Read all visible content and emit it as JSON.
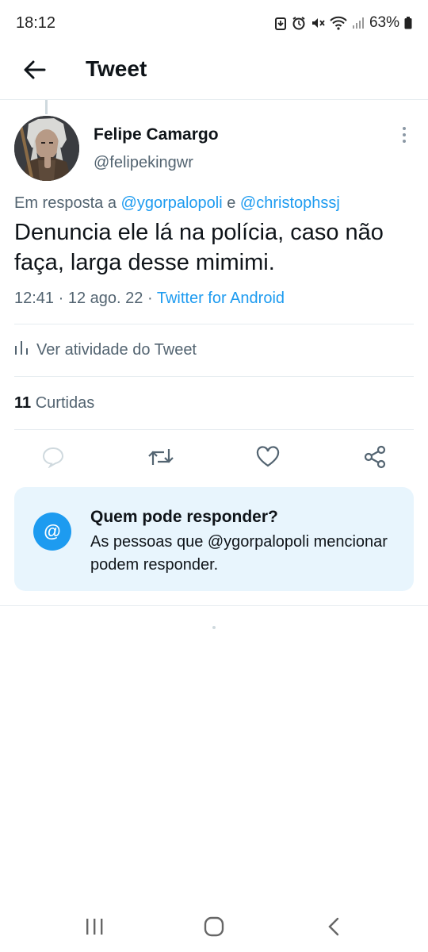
{
  "status_bar": {
    "time": "18:12",
    "battery": "63%",
    "icons": [
      "download-icon",
      "alarm-icon",
      "mute-icon",
      "wifi-icon",
      "signal-icon",
      "battery-icon"
    ]
  },
  "header": {
    "title": "Tweet",
    "back_icon": "arrow-left-icon"
  },
  "tweet": {
    "author_name": "Felipe Camargo",
    "author_handle": "@felipekingwr",
    "reply_prefix": "Em resposta a",
    "reply_mention_1": "@ygorpalopoli",
    "reply_joiner": "e",
    "reply_mention_2": "@christophssj",
    "text": "Denuncia ele lá na polícia, caso não faça, larga desse mimimi.",
    "time": "12:41",
    "date": "12 ago. 22",
    "separator": "·",
    "client": "Twitter for Android"
  },
  "activity": {
    "label": "Ver atividade do Tweet"
  },
  "stats": {
    "likes_count": "11",
    "likes_label": "Curtidas"
  },
  "actions": [
    "reply-icon",
    "retweet-icon",
    "like-icon",
    "share-icon"
  ],
  "who_can_reply": {
    "icon": "@",
    "title": "Quem pode responder?",
    "description": "As pessoas que @ygorpalopoli mencionar podem responder."
  },
  "colors": {
    "accent": "#1d9bf0",
    "secondary_text": "#536471",
    "card_background": "#e8f5fd",
    "divider": "#e6ecf0"
  }
}
